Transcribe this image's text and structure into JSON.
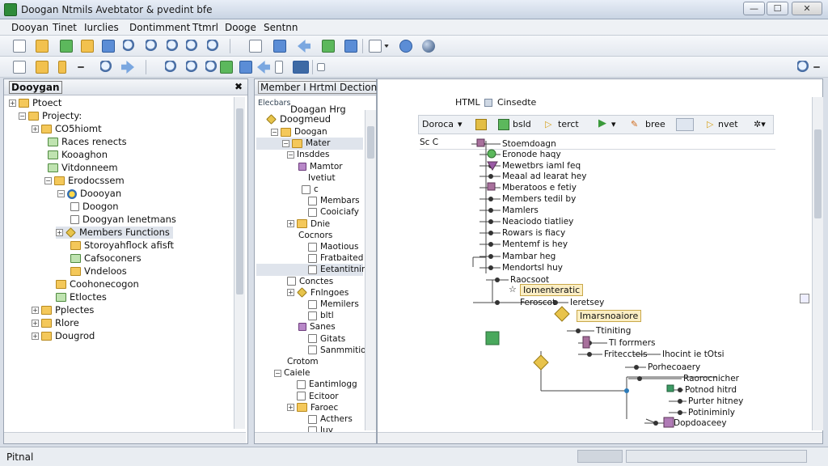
{
  "window": {
    "title": "Doogan Ntmils Avebtator & pvedint bfe",
    "min": "—",
    "max": "☐",
    "close": "✕"
  },
  "menu": [
    "Dooyan",
    "Tinet",
    "Iurclies",
    "Dontimment",
    "Ttmrl",
    "Dooge",
    "Sentnn"
  ],
  "left_panel": {
    "title": "Dooygan",
    "tree": [
      {
        "label": "Ptoect",
        "exp": "⊞",
        "icon": "folder"
      },
      {
        "label": "Projecty:",
        "exp": "⊟",
        "icon": "folder"
      },
      {
        "label": "CO5hiomt",
        "exp": "⊞",
        "icon": "folder"
      },
      {
        "label": "Races renects",
        "exp": "",
        "icon": "greenfold"
      },
      {
        "label": "Kooaghon",
        "exp": "",
        "icon": "greenfold"
      },
      {
        "label": "Vitdonneem",
        "exp": "",
        "icon": "greenfold"
      },
      {
        "label": "Erodocssem",
        "exp": "⊟",
        "icon": "folder"
      },
      {
        "label": "Doooyan",
        "exp": "⊟",
        "icon": "gear"
      },
      {
        "label": "Doogon",
        "exp": "",
        "icon": "docic"
      },
      {
        "label": "Doogyan Ienetmans",
        "exp": "",
        "icon": "docic"
      },
      {
        "label": "Members Functions",
        "exp": "⊞",
        "icon": "diamond"
      },
      {
        "label": "Storoyahflock afisft",
        "exp": "",
        "icon": "folder"
      },
      {
        "label": "Cafsoconers",
        "exp": "",
        "icon": "greenfold"
      },
      {
        "label": "Vndeloos",
        "exp": "",
        "icon": "folder"
      },
      {
        "label": "Coohonecogon",
        "exp": "",
        "icon": "folder"
      },
      {
        "label": "Etloctes",
        "exp": "",
        "icon": "greenfold"
      },
      {
        "label": "Pplectes",
        "exp": "⊞",
        "icon": "folder"
      },
      {
        "label": "Rlore",
        "exp": "⊞",
        "icon": "folder"
      },
      {
        "label": "Dougrod",
        "exp": "⊞",
        "icon": "folder"
      }
    ]
  },
  "mid_panel": {
    "title": "Member I Hrtml Dection",
    "header_small": "Elecbars",
    "header_items": [
      "Doagan Hrg",
      "Doogmeud"
    ],
    "tree": [
      {
        "label": "Doogan",
        "exp": "⊟"
      },
      {
        "label": "Mater",
        "exp": "⊟"
      },
      {
        "label": "Insddes",
        "exp": "⊟"
      },
      {
        "label": "Mamtor",
        "exp": ""
      },
      {
        "label": "Ivetiut",
        "exp": ""
      },
      {
        "label": "c",
        "exp": ""
      },
      {
        "label": "Membars",
        "exp": ""
      },
      {
        "label": "Cooiciafy",
        "exp": ""
      },
      {
        "label": "Dnie",
        "exp": "⊞"
      },
      {
        "label": "Cocnors",
        "exp": ""
      },
      {
        "label": "Maotious",
        "exp": ""
      },
      {
        "label": "Fratbaited",
        "exp": ""
      },
      {
        "label": "Eetantitning",
        "exp": ""
      },
      {
        "label": "Conctes",
        "exp": ""
      },
      {
        "label": "Fnlngoes",
        "exp": "⊞"
      },
      {
        "label": "Memilers",
        "exp": ""
      },
      {
        "label": "bltl",
        "exp": ""
      },
      {
        "label": "Sanes",
        "exp": ""
      },
      {
        "label": "Gitats",
        "exp": ""
      },
      {
        "label": "Sanmmitios",
        "exp": ""
      },
      {
        "label": "Crotom",
        "exp": ""
      },
      {
        "label": "Caiele",
        "exp": "⊟"
      },
      {
        "label": "Eantimlogg",
        "exp": ""
      },
      {
        "label": "Ecitoor",
        "exp": ""
      },
      {
        "label": "Faroec",
        "exp": "⊞"
      },
      {
        "label": "Acthers",
        "exp": ""
      },
      {
        "label": "Iuy",
        "exp": ""
      }
    ]
  },
  "graph": {
    "tab_left": "HTML",
    "tab_right": "Cinsedte",
    "toolbar": [
      "Doroca",
      "bsld",
      "terct",
      "bree",
      "nvet"
    ],
    "sc": "Sc  C",
    "nodes": [
      "Stoemdoagn",
      "Eronode haqy",
      "Mewetbrs iaml feq",
      "Meaal ad learat hey",
      "Mberatoos e fetiy",
      "Members tedil by",
      "Mamlers",
      "Neaciodo tiatliey",
      "Rowars is fiacy",
      "Mentemf is hey",
      "Mambar heg",
      "Mendortsl huy",
      "Raocsoot",
      "Feroscot",
      "Ieretsey",
      "Ttiniting",
      "Tl forrmers",
      "Fritecctels",
      "Porhecoaery",
      "Raorocnicher",
      "Potnod hitrd",
      "Purter hitney",
      "Potiniminly",
      "Dopdoaceey"
    ],
    "callouts": [
      "Iomenteratic",
      "Imarsnoaiore"
    ],
    "side_label": "Ihocint ie tOtsi"
  },
  "status": {
    "text": "Pitnal"
  }
}
